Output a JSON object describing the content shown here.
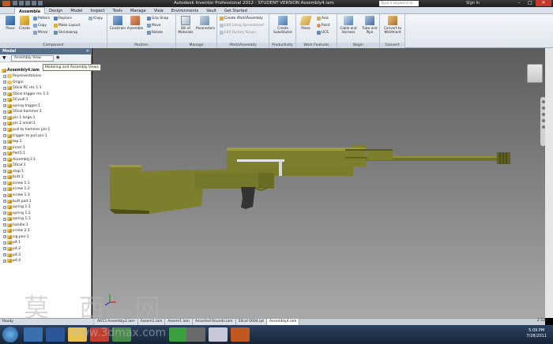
{
  "window": {
    "title": "Autodesk Inventor Professional 2012 - STUDENT VERSION   Assembly4.iam",
    "search_placeholder": "Type a keyword or phrase",
    "sign_in": "Sign In"
  },
  "menu_tabs": [
    "Assemble",
    "Design",
    "Model",
    "Inspect",
    "Tools",
    "Manage",
    "View",
    "Environments",
    "Vault",
    "Get Started"
  ],
  "ribbon": {
    "component": {
      "label": "Component",
      "place": "Place",
      "create": "Create",
      "pattern": "Pattern",
      "copy": "Copy",
      "mirror": "Mirror",
      "replace": "Replace",
      "make_layout": "Make Layout",
      "shrinkwrap": "Shrinkwrap",
      "icopy": "iCopy"
    },
    "position": {
      "label": "Position",
      "constrain": "Constrain",
      "assemble": "Assemble",
      "grip_snap": "Grip Snap",
      "move": "Move",
      "rotate": "Rotate"
    },
    "manage": {
      "label": "Manage",
      "bom": "Bill of Materials",
      "parameters": "Parameters"
    },
    "ipart": {
      "label": "iPart/iAssembly",
      "create": "Create iPart/iAssembly",
      "edit_sheet": "Edit Using Spreadsheet",
      "edit_scope": "Edit Factory Scope"
    },
    "productivity": {
      "label": "Productivity",
      "create_substitutes": "Create Substitutes"
    },
    "work_features": {
      "label": "Work Features",
      "plane": "Plane",
      "axis": "Axis",
      "point": "Point",
      "ucs": "UCS"
    },
    "begin": {
      "label": "Begin",
      "cable": "Cable and Harness",
      "tube": "Tube and Pipe"
    },
    "convert": {
      "label": "Convert",
      "weldment": "Convert to Weldment"
    }
  },
  "browser": {
    "title": "Model",
    "view_selector": "Assembly View",
    "tooltip": "Modeling and Assembly Views",
    "root": "Assembly4.iam",
    "items": [
      "Representations",
      "Origin",
      "50cal RC mc 1:1",
      "50cal trigger mc 1:1",
      "50 pull:1",
      "spring trigger:1",
      "50cal hammer:1",
      "pin 1 large:1",
      "pin 2 small:1",
      "pull to hammer pin:1",
      "trigger to pull pin:1",
      "top:1",
      "inner:1",
      "Part1:1",
      "Assembly1:1",
      "50cal:1",
      "stop:1",
      "butt:1",
      "screw 1:1",
      "screw 1:2",
      "screw 1:3",
      "butt pad:1",
      "spring 1:1",
      "spring 1:2",
      "spring 1:3",
      "handle:1",
      "screw 2:1",
      "sig.pen:1",
      "p4:1",
      "p4:2",
      "p4:3",
      "p4:4"
    ]
  },
  "doc_tabs": [
    "AR15 Assembly2.iam",
    "Assem1.iam",
    "Assem1.iam",
    "Assorted Rounds.iam",
    "50cal 0004.ipt",
    "Assembly4.iam"
  ],
  "status": {
    "ready": "Ready",
    "count_a": "2",
    "count_b": "138"
  },
  "taskbar": {
    "time": "5:09 PM",
    "date": "7/28/2011"
  },
  "watermark": {
    "chars": "莫 西 网",
    "url": "www.3dmax.com"
  },
  "colors": {
    "gun_body": "#7d7f2c",
    "gun_dark": "#5a5b1c",
    "grip": "#3a3a3a",
    "ribbon_bg": "#e6ecf2",
    "browser_header": "#56708c"
  }
}
